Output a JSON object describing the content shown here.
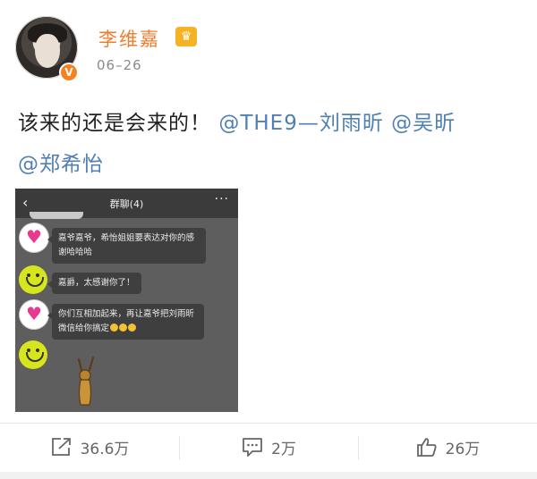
{
  "post": {
    "username": "李维嘉",
    "timestamp": "06–26",
    "text_plain": "该来的还是会来的！",
    "mentions": [
      "@THE9—刘雨昕",
      "@吴昕",
      "@郑希怡"
    ]
  },
  "embedded_screenshot": {
    "title": "群聊(4)",
    "back_glyph": "‹",
    "more_glyph": "···",
    "messages": [
      {
        "sender_icon": "heart-avatar",
        "text": "嘉爷嘉爷，希怡姐姐要表达对你的感谢哈哈哈"
      },
      {
        "sender_icon": "smiley-avatar",
        "text": "嘉爵，太感谢你了！"
      },
      {
        "sender_icon": "heart-avatar",
        "text": "你们互相加起来，再让嘉爷把刘雨昕微信给你搞定"
      },
      {
        "sender_icon": "smiley-avatar",
        "text": ""
      }
    ]
  },
  "actions": {
    "repost_count": "36.6万",
    "comment_count": "2万",
    "like_count": "26万"
  },
  "colors": {
    "username": "#ef7d2e",
    "mention": "#4f7fb3",
    "verified_badge": "#f6821f"
  }
}
